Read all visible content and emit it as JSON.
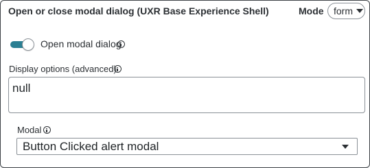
{
  "panel": {
    "title": "Open or close modal dialog (UXR Base Experience Shell)",
    "mode_label": "Mode",
    "mode_value": "form"
  },
  "toggle": {
    "label": "Open modal dialog",
    "checked": true,
    "accent_color": "#2a7f93"
  },
  "display_options": {
    "label": "Display options (advanced)",
    "value": "null"
  },
  "modal": {
    "label": "Modal",
    "selected": "Button Clicked alert modal"
  },
  "icons": {
    "info": "info-icon",
    "dropdown": "chevron-down-icon"
  }
}
